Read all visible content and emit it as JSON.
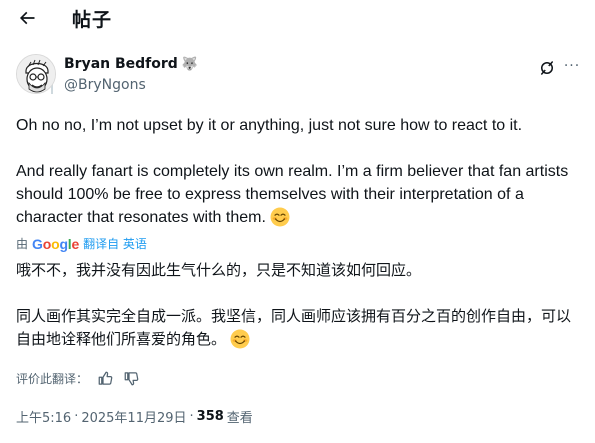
{
  "header": {
    "back_icon": "arrow-left-icon",
    "title": "帖子"
  },
  "tweet": {
    "author": {
      "name": "Bryan Bedford",
      "name_badge": "🐺",
      "handle": "@BryNgons"
    },
    "actions": {
      "grok_icon": "grok-icon",
      "more_icon": "more-horizontal-icon",
      "more_label": "···"
    },
    "text": {
      "paragraph_1": "Oh no no, I’m not upset by it or anything, just not sure how to react to it.",
      "paragraph_2": "And really fanart is completely its own realm. I’m a firm believer that fan artists should 100% be free to express themselves with their interpretation of a character that resonates with them.",
      "emoji": "😊"
    },
    "translation": {
      "by_prefix": "由",
      "provider": "Google",
      "link_text": "翻译自 英语",
      "paragraph_1": "哦不不，我并没有因此生气什么的，只是不知道该如何回应。",
      "paragraph_2": "同人画作其实完全自成一派。我坚信，同人画师应该拥有百分之百的创作自由，可以自由地诠释他们所喜爱的角色。",
      "rate_label": "评价此翻译："
    },
    "meta": {
      "time": "上午5:16",
      "separator": "·",
      "date": "2025年11月29日",
      "views_count": "358",
      "views_label": "查看"
    }
  },
  "colors": {
    "text_primary": "#0f1419",
    "text_secondary": "#536471",
    "link": "#1d9bf0"
  }
}
